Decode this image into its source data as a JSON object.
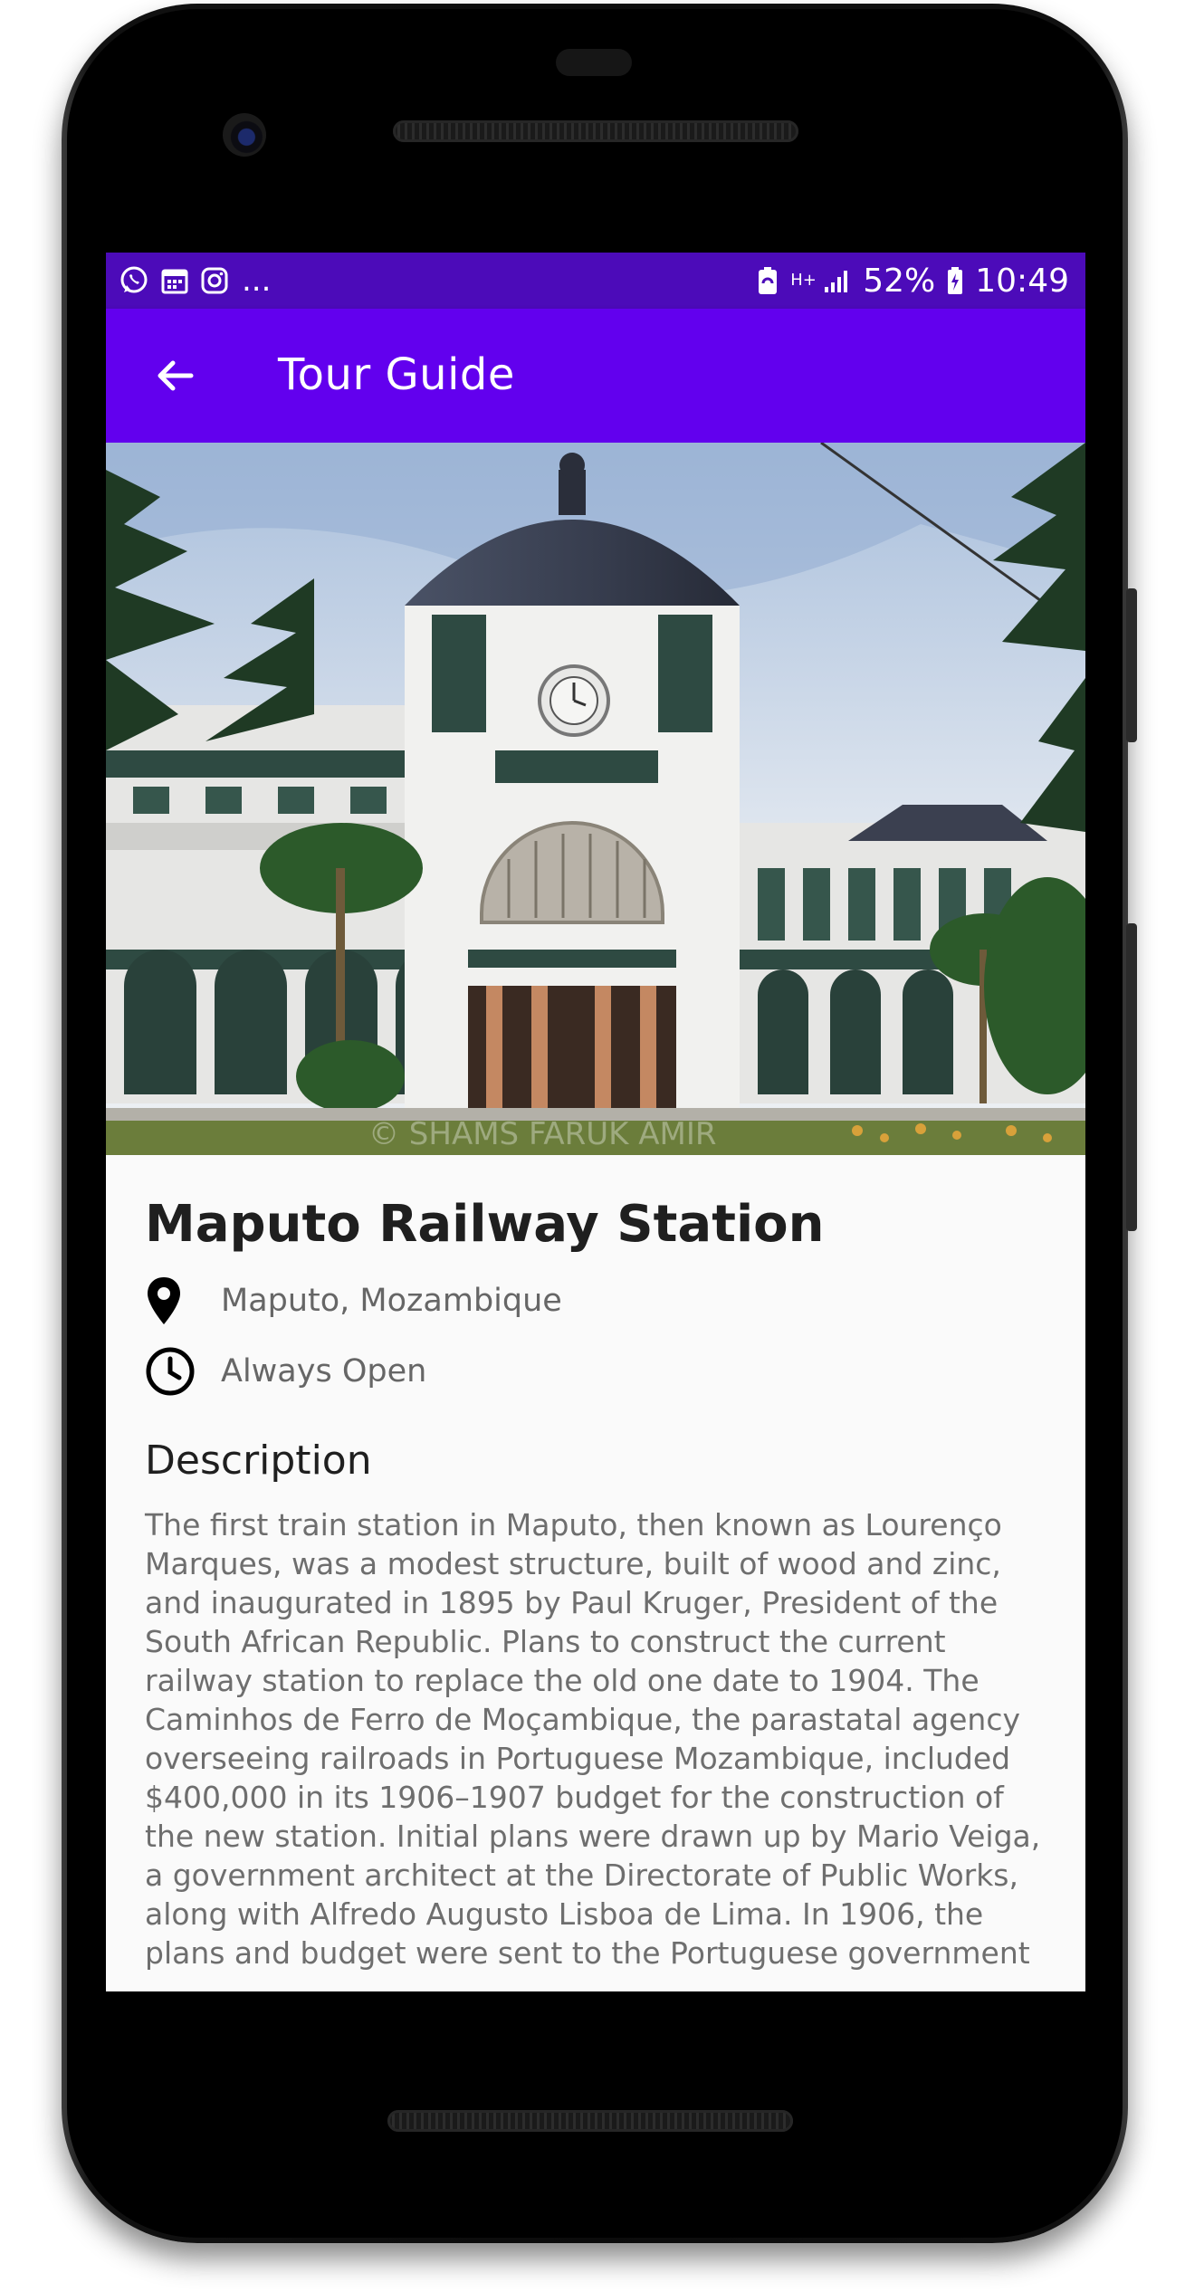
{
  "statusbar": {
    "notification_icons": [
      "whatsapp-icon",
      "calendar-icon",
      "instagram-icon"
    ],
    "overflow": "...",
    "network_label": "H+",
    "battery": "52%",
    "time": "10:49"
  },
  "toolbar": {
    "back_icon": "arrow-left-icon",
    "title": "Tour Guide"
  },
  "hero": {
    "subject": "Maputo railway station building photo",
    "watermark": "© SHAMS FARUK AMIR"
  },
  "place": {
    "title": "Maputo Railway Station",
    "location": "Maputo, Mozambique",
    "hours": "Always Open"
  },
  "description": {
    "heading": "Description",
    "body": "The first train station in Maputo, then known as Lourenço Marques, was a modest structure, built of wood and zinc, and inaugurated in 1895 by Paul Kruger, President of the South African Republic. Plans to construct the current railway station to replace the old one date to 1904. The Caminhos de Ferro de Moçambique, the parastatal agency overseeing railroads in Portuguese Mozambique, included $400,000 in its 1906–1907 budget for the construction of the new station. Initial plans were drawn up by Mario Veiga, a government architect at the Directorate of Public Works, along with Alfredo Augusto Lisboa de Lima. In 1906, the plans and budget were sent to the Portuguese government"
  },
  "colors": {
    "status_bar": "#4c0bb9",
    "app_bar": "#6200ee",
    "background": "#fafafa"
  }
}
